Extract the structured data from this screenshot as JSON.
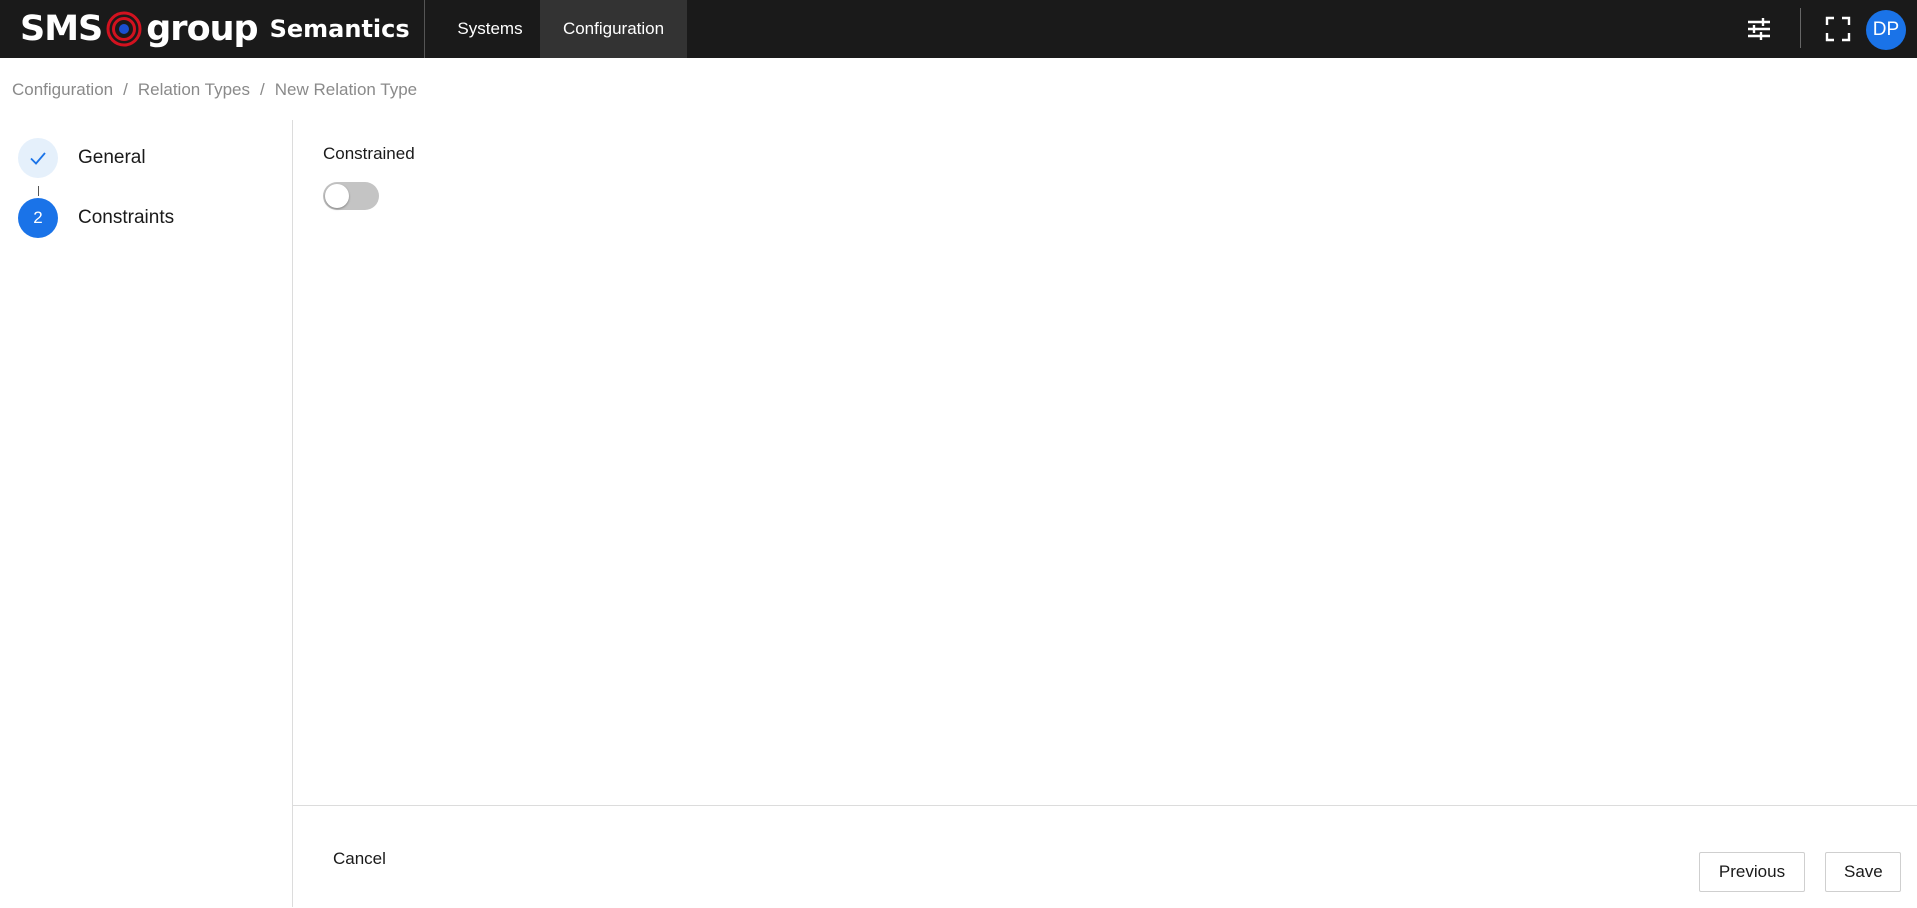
{
  "header": {
    "brand_left": "SMS",
    "brand_right": "group",
    "product": "Semantics",
    "nav": [
      {
        "label": "Systems",
        "active": false
      },
      {
        "label": "Configuration",
        "active": true
      }
    ],
    "icons": {
      "settings": "sliders-icon",
      "fullscreen": "fullscreen-icon"
    },
    "avatar_initials": "DP"
  },
  "breadcrumb": {
    "items": [
      "Configuration",
      "Relation Types",
      "New Relation Type"
    ],
    "separator": "/"
  },
  "stepper": {
    "steps": [
      {
        "index": "",
        "label": "General",
        "state": "done",
        "icon": "check-icon"
      },
      {
        "index": "2",
        "label": "Constraints",
        "state": "active"
      }
    ]
  },
  "form": {
    "constrained_label": "Constrained",
    "constrained_value": false
  },
  "footer": {
    "cancel_label": "Cancel",
    "previous_label": "Previous",
    "save_label": "Save"
  },
  "colors": {
    "topbar": "#1a1a1a",
    "accent": "#1a73e8",
    "brand_red": "#d2121f"
  }
}
